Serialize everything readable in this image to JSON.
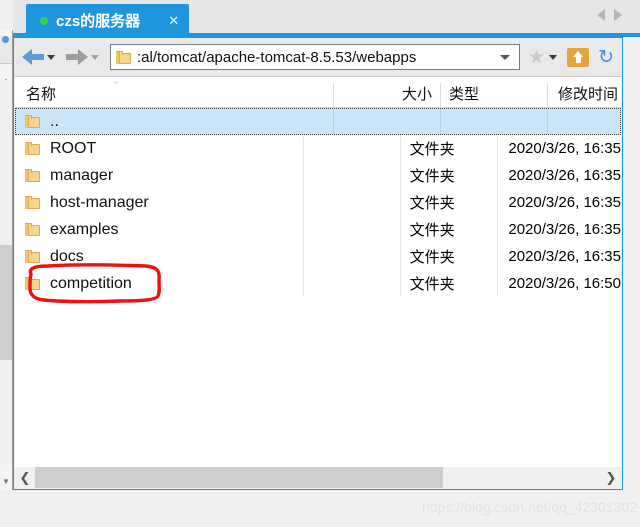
{
  "window": {
    "tab": {
      "title": "czs的服务器",
      "status_dot_color": "#3ad04a",
      "close_label": "✕",
      "tab_color": "#1e96dd"
    },
    "tab_nav": {
      "prev_icon": "triangle-left-icon",
      "next_icon": "triangle-right-icon"
    }
  },
  "toolbar": {
    "back_icon": "arrow-left-icon",
    "back_dropdown_icon": "caret-down-icon",
    "forward_icon": "arrow-right-icon",
    "forward_dropdown_icon": "caret-down-icon",
    "address": {
      "folder_icon": "folder-icon",
      "path": ":al/tomcat/apache-tomcat-8.5.53/webapps",
      "placeholder": "",
      "dropdown_icon": "caret-down-icon"
    },
    "bookmark_icon": "star-icon",
    "bookmark_label": "★",
    "bookmark_dropdown_icon": "caret-down-icon",
    "up_folder_icon": "up-folder-icon",
    "refresh_icon": "refresh-icon",
    "refresh_label": "↻"
  },
  "file_list": {
    "columns": [
      {
        "key": "name",
        "label": "名称"
      },
      {
        "key": "size",
        "label": "大小"
      },
      {
        "key": "type",
        "label": "类型"
      },
      {
        "key": "time",
        "label": "修改时间"
      }
    ],
    "sort_indicator": "⌄",
    "rows": [
      {
        "name": "..",
        "size": "",
        "type": "",
        "time": "",
        "selected": true
      },
      {
        "name": "ROOT",
        "size": "",
        "type": "文件夹",
        "time": "2020/3/26, 16:35",
        "selected": false
      },
      {
        "name": "manager",
        "size": "",
        "type": "文件夹",
        "time": "2020/3/26, 16:35",
        "selected": false
      },
      {
        "name": "host-manager",
        "size": "",
        "type": "文件夹",
        "time": "2020/3/26, 16:35",
        "selected": false
      },
      {
        "name": "examples",
        "size": "",
        "type": "文件夹",
        "time": "2020/3/26, 16:35",
        "selected": false
      },
      {
        "name": "docs",
        "size": "",
        "type": "文件夹",
        "time": "2020/3/26, 16:35",
        "selected": false
      },
      {
        "name": "competition",
        "size": "",
        "type": "文件夹",
        "time": "2020/3/26, 16:50",
        "selected": false
      }
    ]
  },
  "scrollbar": {
    "left_arrow": "❮",
    "right_arrow": "❯"
  },
  "annotation": {
    "color": "#ee1111",
    "target": "competition"
  },
  "watermark": {
    "text": "https://blog.csdn.net/qq_42301302"
  }
}
